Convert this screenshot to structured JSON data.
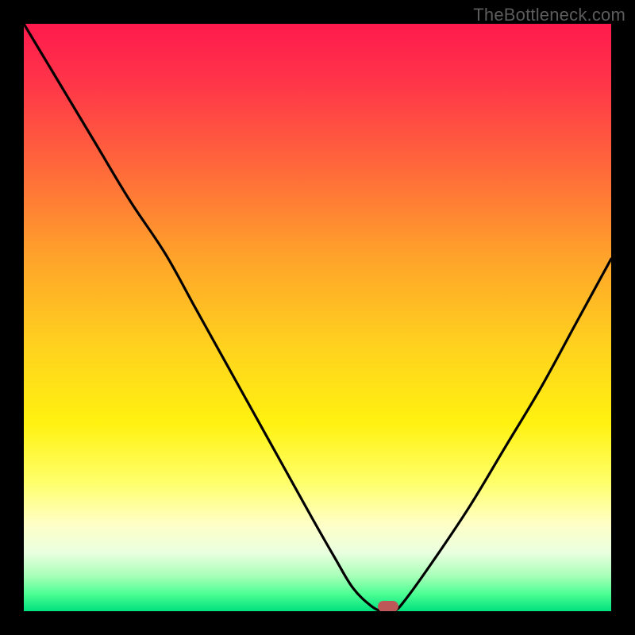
{
  "watermark": "TheBottleneck.com",
  "marker": {
    "color": "#be5858",
    "x_pct": 62,
    "y_pct": 99.2
  },
  "gradient_stops": [
    {
      "offset": 0.0,
      "color": "#ff1a4d"
    },
    {
      "offset": 0.1,
      "color": "#ff3549"
    },
    {
      "offset": 0.25,
      "color": "#ff6a3a"
    },
    {
      "offset": 0.4,
      "color": "#ffa42a"
    },
    {
      "offset": 0.55,
      "color": "#ffd21e"
    },
    {
      "offset": 0.68,
      "color": "#fff210"
    },
    {
      "offset": 0.78,
      "color": "#ffff6a"
    },
    {
      "offset": 0.85,
      "color": "#ffffc5"
    },
    {
      "offset": 0.9,
      "color": "#eaffe0"
    },
    {
      "offset": 0.94,
      "color": "#a8ffb8"
    },
    {
      "offset": 0.97,
      "color": "#4eff94"
    },
    {
      "offset": 1.0,
      "color": "#00e17e"
    }
  ],
  "chart_data": {
    "type": "line",
    "title": "",
    "xlabel": "",
    "ylabel": "",
    "xlim": [
      0,
      100
    ],
    "ylim": [
      0,
      100
    ],
    "series": [
      {
        "name": "bottleneck-curve",
        "x": [
          0,
          6,
          12,
          18,
          24,
          29,
          34,
          39,
          44,
          49,
          53,
          56,
          59,
          61,
          63,
          65,
          70,
          76,
          82,
          88,
          94,
          100
        ],
        "values": [
          100,
          90,
          80,
          70,
          61,
          52,
          43,
          34,
          25,
          16,
          9,
          4,
          1,
          0,
          0,
          2,
          9,
          18,
          28,
          38,
          49,
          60
        ]
      }
    ],
    "annotations": [
      {
        "type": "marker",
        "x": 62,
        "y": 0,
        "label": "optimal-point"
      }
    ]
  }
}
